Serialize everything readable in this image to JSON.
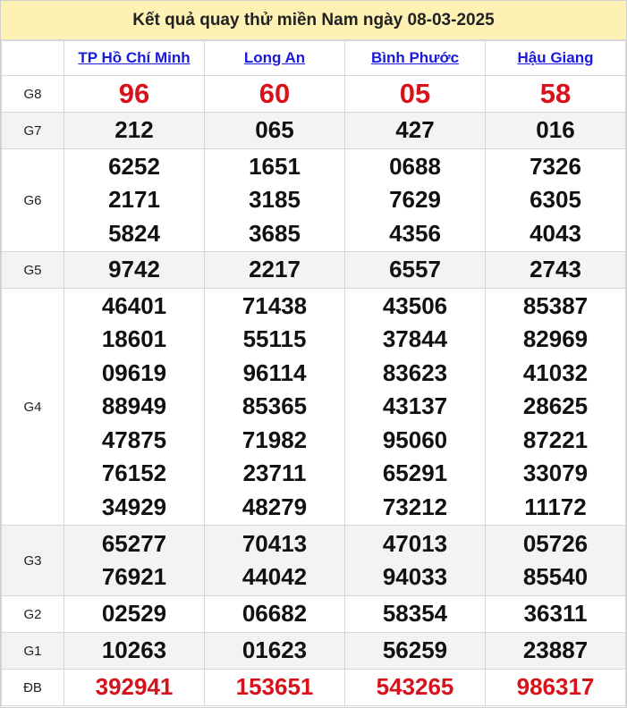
{
  "title": "Kết quả quay thử miền Nam ngày 08-03-2025",
  "provinces": [
    "TP Hồ Chí Minh",
    "Long An",
    "Bình Phước",
    "Hậu Giang"
  ],
  "prizes": [
    {
      "label": "G8",
      "style": "red-big",
      "rows": [
        [
          "96"
        ],
        [
          "60"
        ],
        [
          "05"
        ],
        [
          "58"
        ]
      ]
    },
    {
      "label": "G7",
      "style": "normal",
      "rows": [
        [
          "212"
        ],
        [
          "065"
        ],
        [
          "427"
        ],
        [
          "016"
        ]
      ]
    },
    {
      "label": "G6",
      "style": "normal",
      "rows": [
        [
          "6252",
          "2171",
          "5824"
        ],
        [
          "1651",
          "3185",
          "3685"
        ],
        [
          "0688",
          "7629",
          "4356"
        ],
        [
          "7326",
          "6305",
          "4043"
        ]
      ]
    },
    {
      "label": "G5",
      "style": "normal",
      "rows": [
        [
          "9742"
        ],
        [
          "2217"
        ],
        [
          "6557"
        ],
        [
          "2743"
        ]
      ]
    },
    {
      "label": "G4",
      "style": "normal",
      "rows": [
        [
          "46401",
          "18601",
          "09619",
          "88949",
          "47875",
          "76152",
          "34929"
        ],
        [
          "71438",
          "55115",
          "96114",
          "85365",
          "71982",
          "23711",
          "48279"
        ],
        [
          "43506",
          "37844",
          "83623",
          "43137",
          "95060",
          "65291",
          "73212"
        ],
        [
          "85387",
          "82969",
          "41032",
          "28625",
          "87221",
          "33079",
          "11172"
        ]
      ]
    },
    {
      "label": "G3",
      "style": "normal",
      "rows": [
        [
          "65277",
          "76921"
        ],
        [
          "70413",
          "44042"
        ],
        [
          "47013",
          "94033"
        ],
        [
          "05726",
          "85540"
        ]
      ]
    },
    {
      "label": "G2",
      "style": "normal",
      "rows": [
        [
          "02529"
        ],
        [
          "06682"
        ],
        [
          "58354"
        ],
        [
          "36311"
        ]
      ]
    },
    {
      "label": "G1",
      "style": "normal",
      "rows": [
        [
          "10263"
        ],
        [
          "01623"
        ],
        [
          "56259"
        ],
        [
          "23887"
        ]
      ]
    },
    {
      "label": "ĐB",
      "style": "red",
      "rows": [
        [
          "392941"
        ],
        [
          "153651"
        ],
        [
          "543265"
        ],
        [
          "986317"
        ]
      ]
    }
  ]
}
